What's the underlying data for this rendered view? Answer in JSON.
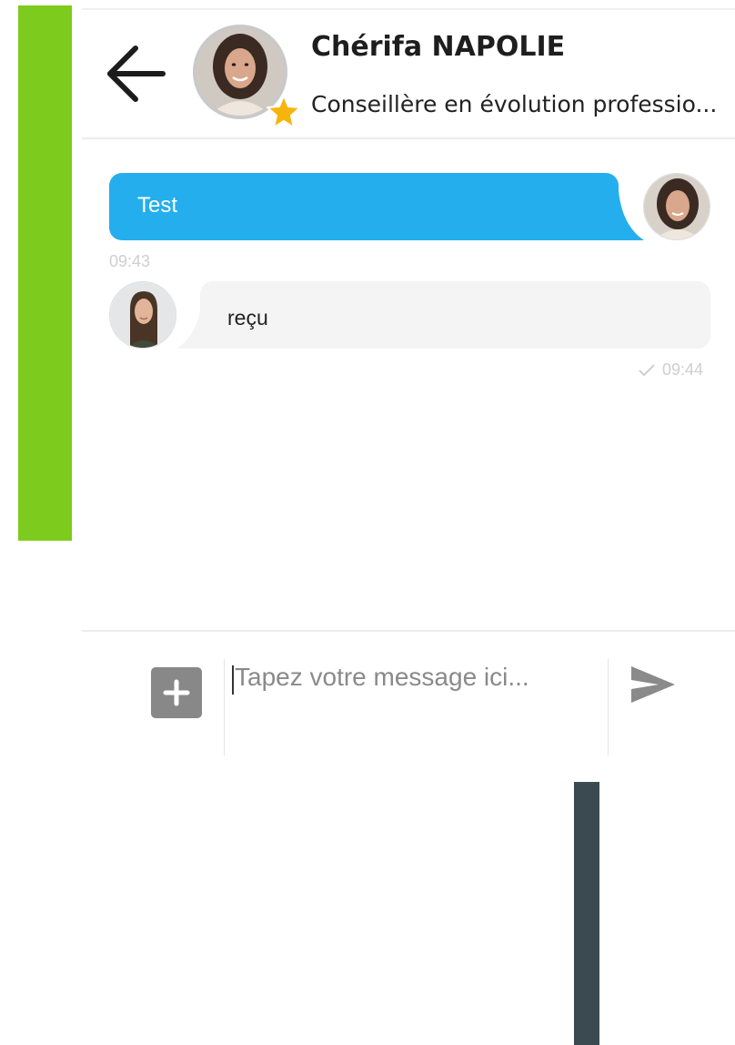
{
  "header": {
    "contact_name": "Chérifa NAPOLIE",
    "contact_subtitle": "Conseillère en évolution professio..."
  },
  "messages": [
    {
      "direction": "outgoing",
      "text": "Test",
      "time": "09:43"
    },
    {
      "direction": "incoming",
      "text": "reçu",
      "time": "09:44",
      "receipt": "check-icon"
    }
  ],
  "composer": {
    "placeholder": "Tapez votre message ici...",
    "add_icon": "plus-icon",
    "send_icon": "send-icon"
  },
  "icons": {
    "back": "arrow-left-icon",
    "badge": "star-icon"
  },
  "colors": {
    "sidebar_accent": "#7dcb1d",
    "outgoing_bubble": "#24aeed",
    "incoming_bubble": "#f4f4f4",
    "star": "#f5b50b",
    "dark_strip": "#3b4a51"
  }
}
